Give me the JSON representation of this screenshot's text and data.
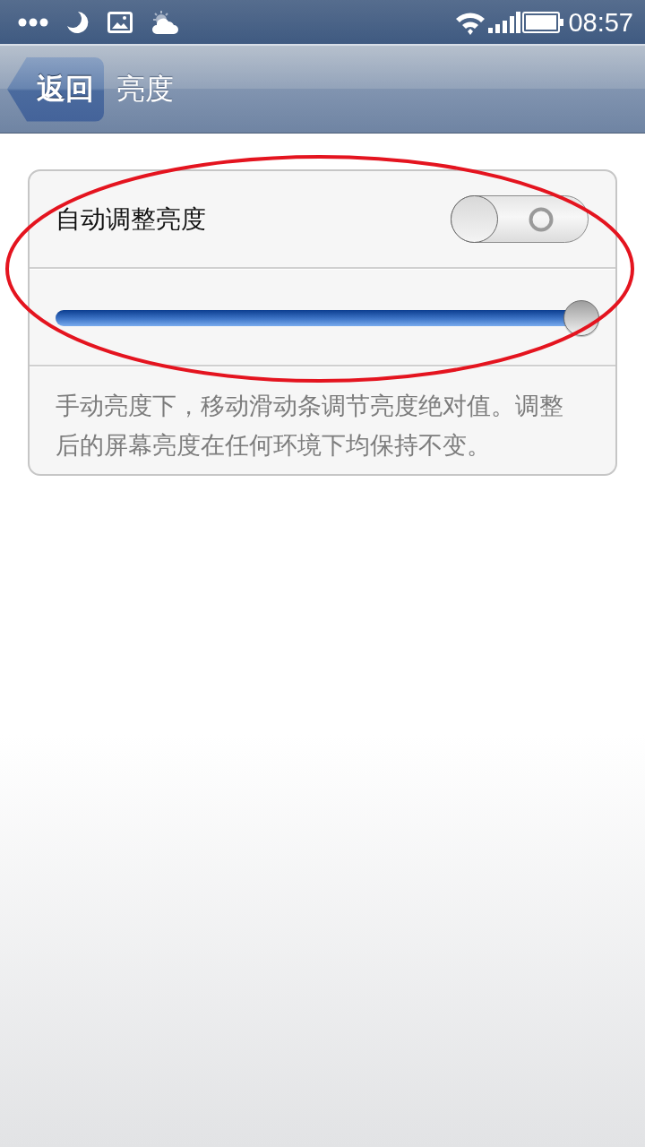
{
  "status_bar": {
    "time": "08:57"
  },
  "nav_bar": {
    "back_button": "返回",
    "title": "亮度"
  },
  "settings": {
    "auto_brightness": {
      "label": "自动调整亮度",
      "on": false
    },
    "brightness_slider": {
      "level": 1.0
    },
    "description": "手动亮度下，移动滑动条调节亮度绝对值。调整后的屏幕亮度在任何环境下均保持不变。"
  }
}
